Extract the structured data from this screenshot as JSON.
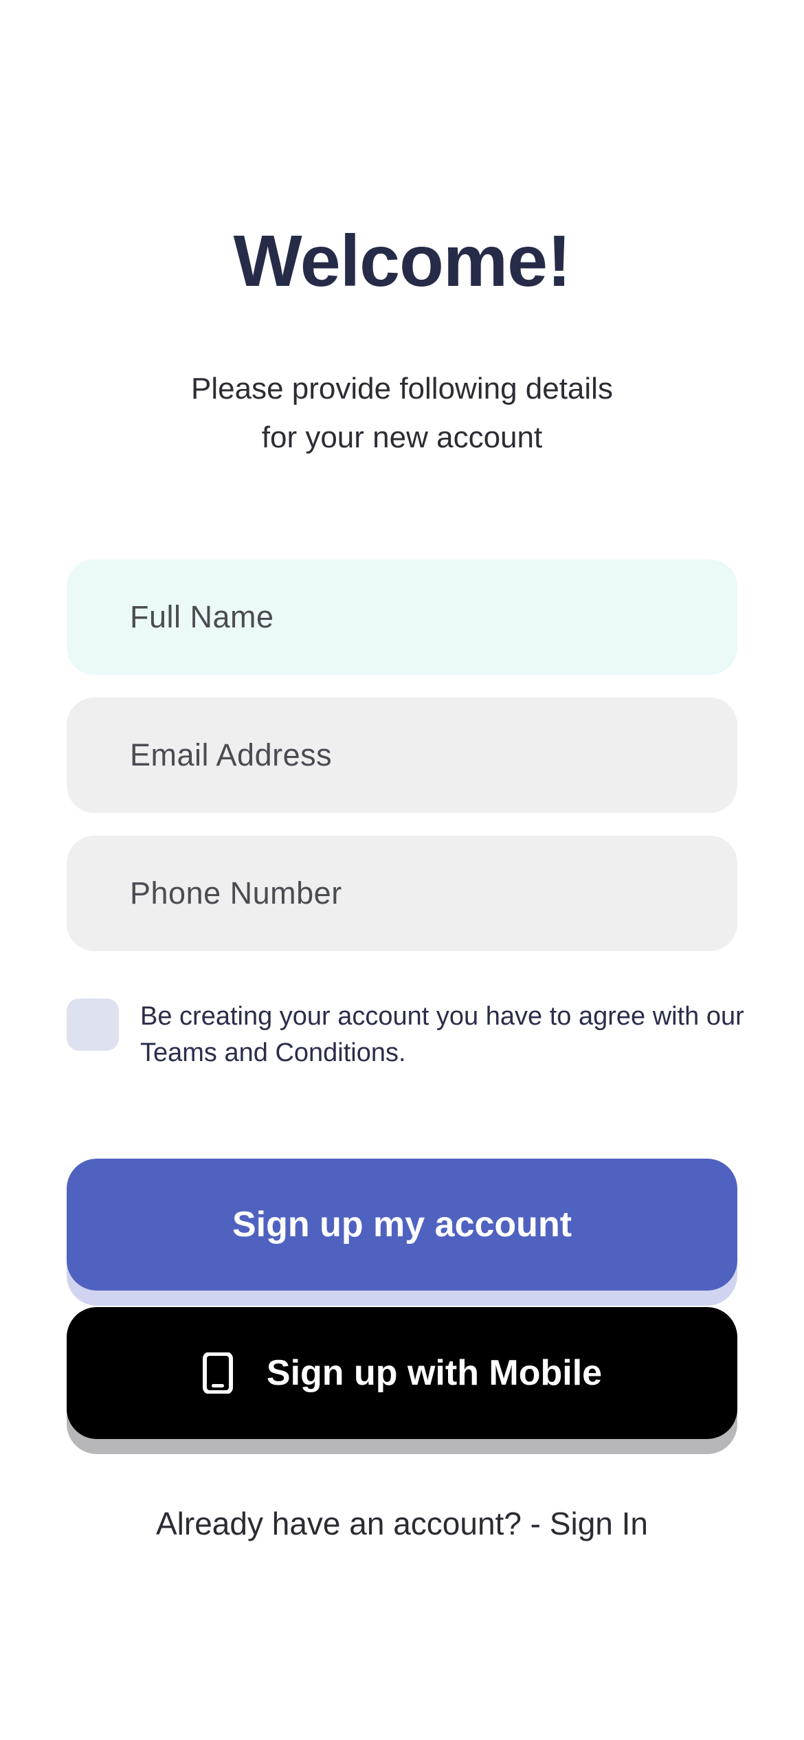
{
  "header": {
    "title": "Welcome!",
    "subtitle": "Please provide following details for your new account"
  },
  "form": {
    "full_name_placeholder": "Full Name",
    "email_placeholder": "Email Address",
    "phone_placeholder": "Phone Number",
    "full_name_value": "",
    "email_value": "",
    "phone_value": ""
  },
  "agreement": {
    "checked": false,
    "text": "Be creating your account you have to agree with our Teams and Conditions."
  },
  "buttons": {
    "signup_label": "Sign up my account",
    "mobile_label": "Sign up with Mobile",
    "mobile_icon": "mobile-phone-icon"
  },
  "footer": {
    "prompt": "Already have an account? - ",
    "link": "Sign In"
  },
  "colors": {
    "primary": "#5062c0",
    "dark": "#000000",
    "title": "#262b48",
    "active_field": "#ebf9f9",
    "field": "#efefef",
    "checkbox": "#dde1f0"
  }
}
